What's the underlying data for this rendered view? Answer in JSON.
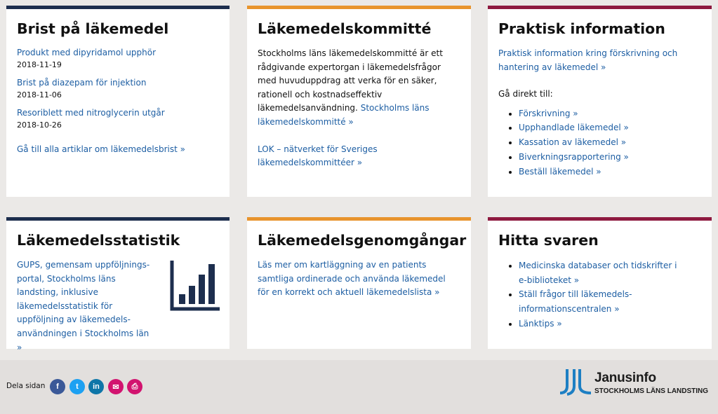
{
  "brist": {
    "title": "Brist på läkemedel",
    "items": [
      {
        "title": "Produkt med dipyridamol upphör",
        "date": "2018-11-19"
      },
      {
        "title": "Brist på diazepam för injektion",
        "date": "2018-11-06"
      },
      {
        "title": "Resoriblett med nitroglycerin utgår",
        "date": "2018-10-26"
      }
    ],
    "all_link": "Gå till alla artiklar om läkemedelsbrist »"
  },
  "kommitte": {
    "title": "Läkemedelskommitté",
    "text": "Stockholms läns läkemedelskommitté är ett rådgivande expertorgan i läkemedelsfrågor med huvuduppdrag att verka för en säker, rationell och kostnadseffektiv läkemedelsanvändning.",
    "link1": "Stockholms läns läkemedelskommitté »",
    "link2": "LOK – nätverket för Sveriges läkemedelskommittéer »"
  },
  "praktisk": {
    "title": "Praktisk information",
    "intro_link": "Praktisk information kring förskrivning och hantering av läkemedel »",
    "direct_label": "Gå direkt till:",
    "links": [
      "Förskrivning »",
      "Upphandlade läkemedel »",
      "Kassation av läkemedel »",
      "Biverkningsrapportering »",
      "Beställ läkemedel »"
    ]
  },
  "statistik": {
    "title": "Läkemedelsstatistik",
    "link": "GUPS, gemensam uppföljnings-portal, Stockholms läns landsting, inklusive läkemedelsstatistik för uppföljning av läkemedels-användningen i Stockholms län »"
  },
  "genomgangar": {
    "title": "Läkemedelsgenomgångar",
    "link": "Läs mer om kartläggning av en patients samtliga ordinerade och använda läkemedel för en korrekt och aktuell läkemedelslista »"
  },
  "hitta": {
    "title": "Hitta svaren",
    "links": [
      "Medicinska databaser och tidskrifter i e-biblioteket »",
      "Ställ frågor till läkemedels-informationscentralen »",
      "Länktips »"
    ]
  },
  "footer": {
    "share_label": "Dela sidan",
    "social": [
      {
        "icon": "facebook-icon",
        "glyph": "f",
        "color": "#3b5998"
      },
      {
        "icon": "twitter-icon",
        "glyph": "t",
        "color": "#1da1f2"
      },
      {
        "icon": "linkedin-icon",
        "glyph": "in",
        "color": "#0e76a8"
      },
      {
        "icon": "email-icon",
        "glyph": "✉",
        "color": "#d2136f"
      },
      {
        "icon": "print-icon",
        "glyph": "⎙",
        "color": "#d2136f"
      }
    ],
    "logo_name": "Janusinfo",
    "logo_sub": "STOCKHOLMS LÄNS LANDSTING",
    "logo_color": "#1d7fc3"
  },
  "colors": {
    "navy": "#1d2e4e",
    "orange": "#e8942d",
    "red": "#8e1a40",
    "link": "#1d5ea3"
  }
}
